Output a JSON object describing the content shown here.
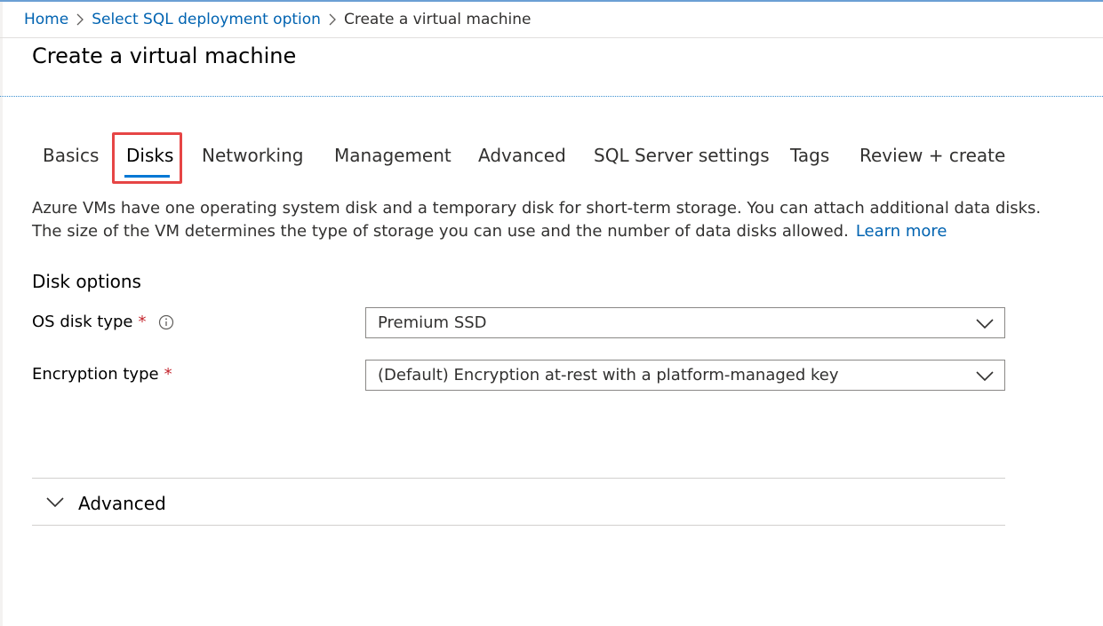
{
  "breadcrumb": {
    "items": [
      "Home",
      "Select SQL deployment option",
      "Create a virtual machine"
    ]
  },
  "page": {
    "title": "Create a virtual machine"
  },
  "tabs": {
    "items": [
      "Basics",
      "Disks",
      "Networking",
      "Management",
      "Advanced",
      "SQL Server settings",
      "Tags",
      "Review + create"
    ],
    "active": "Disks"
  },
  "description": {
    "line1": "Azure VMs have one operating system disk and a temporary disk for short-term storage. You can attach additional data disks.",
    "line2": "The size of the VM determines the type of storage you can use and the number of data disks allowed.",
    "link": "Learn more"
  },
  "disk_options": {
    "title": "Disk options",
    "os_disk_type": {
      "label": "OS disk type",
      "required_mark": "*",
      "value": "Premium SSD"
    },
    "encryption_type": {
      "label": "Encryption type",
      "required_mark": "*",
      "value": "(Default) Encryption at-rest with a platform-managed key"
    }
  },
  "advanced_section": {
    "label": "Advanced"
  },
  "colors": {
    "link": "#0063b1",
    "accent": "#0078d4",
    "highlight": "#e64545",
    "required": "#c4262e"
  },
  "icons": {
    "breadcrumb_separator": "chevron-right-icon",
    "info": "info-icon",
    "dropdown": "chevron-down-icon"
  }
}
